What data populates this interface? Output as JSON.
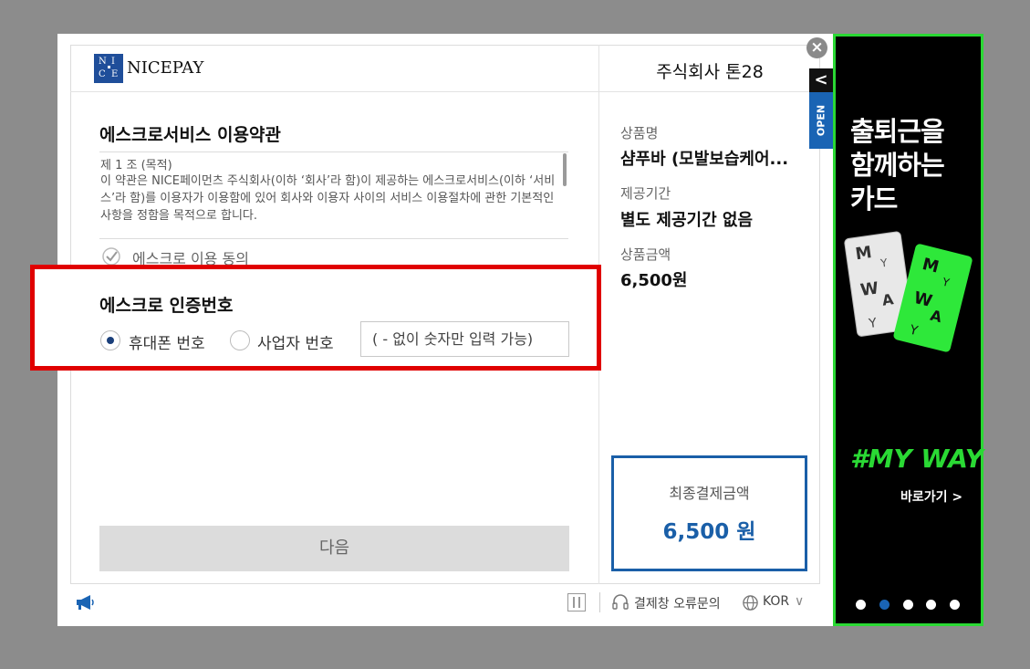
{
  "header": {
    "logo_letters": [
      "N",
      "I",
      "C",
      "E"
    ],
    "logo_text": "NICEPAY",
    "merchant": "주식회사 톤28",
    "close_symbol": "×",
    "open_tab_arrow": "<",
    "open_tab_label": "OPEN"
  },
  "terms": {
    "title": "에스크로서비스 이용약관",
    "line1": "제 1 조 (목적)",
    "body": "이 약관은 NICE페이먼츠 주식회사(이하 ‘회사’라 함)이 제공하는 에스크로서비스(이하 ‘서비스’라 함)를 이용자가 이용함에 있어 회사와 이용자 사이의 서비스 이용절차에 관한 기본적인 사항을 정함을 목적으로 합니다.",
    "agree_label": "에스크로 이용 동의",
    "agree_checked": true
  },
  "certification": {
    "title": "에스크로 인증번호",
    "options": [
      "휴대폰 번호",
      "사업자 번호"
    ],
    "selected": "휴대폰 번호",
    "input_placeholder": "( - 없이 숫자만 입력 가능)",
    "input_value": ""
  },
  "next_button": "다음",
  "product": {
    "name_label": "상품명",
    "name_value": "샴푸바 (모발보습케어...",
    "period_label": "제공기간",
    "period_value": "별도 제공기간 없음",
    "amount_label": "상품금액",
    "amount_value": "6,500원"
  },
  "total": {
    "label": "최종결제금액",
    "value": "6,500 원"
  },
  "footer": {
    "error_inquiry": "결제창 오류문의",
    "language": "KOR",
    "language_chevron": "∨"
  },
  "ad": {
    "headline": [
      "출퇴근을",
      "함께하는",
      "카드"
    ],
    "card_letters": [
      "M",
      "Y",
      "W",
      "A",
      "Y"
    ],
    "slogan": "#MY WAY",
    "link": "바로가기 >",
    "slide_count": 5,
    "active_slide": 2
  },
  "colors": {
    "brand_blue": "#1a5fa8",
    "highlight_red": "#e00000",
    "ad_green": "#2ad934"
  }
}
